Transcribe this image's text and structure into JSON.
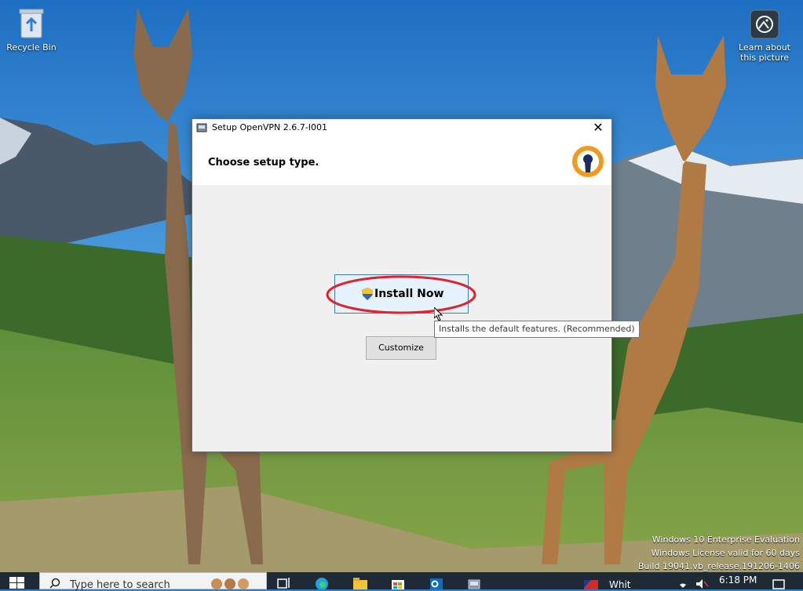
{
  "desktop": {
    "recycle_bin_label": "Recycle Bin",
    "learn_label_line1": "Learn about",
    "learn_label_line2": "this picture"
  },
  "dialog": {
    "title": "Setup OpenVPN 2.6.7-I001",
    "close_glyph": "✕",
    "heading": "Choose setup type.",
    "install_now_label": "Install Now",
    "customize_label": "Customize",
    "tooltip": "Installs the default features. (Recommended)"
  },
  "watermark": {
    "line1": "Windows 10 Enterprise Evaluation",
    "line2": "Windows License valid for 60 days",
    "line3": "Build 19041.vb_release.191206-1406"
  },
  "taskbar": {
    "search_placeholder": "Type here to search",
    "news_text": "Whit",
    "time": "6:18 PM"
  },
  "colors": {
    "annotation": "#e0232e",
    "openvpn_orange": "#f39a1e",
    "openvpn_navy": "#1a2b5e"
  },
  "icons": [
    "recycle-bin-icon",
    "learn-about-picture-icon",
    "openvpn-logo",
    "uac-shield-icon",
    "windows-start-icon",
    "search-icon",
    "task-view-icon",
    "edge-icon",
    "file-explorer-icon",
    "store-icon",
    "outlook-icon",
    "setup-app-icon",
    "mlb-icon",
    "wifi-icon",
    "volume-icon",
    "notification-icon"
  ]
}
